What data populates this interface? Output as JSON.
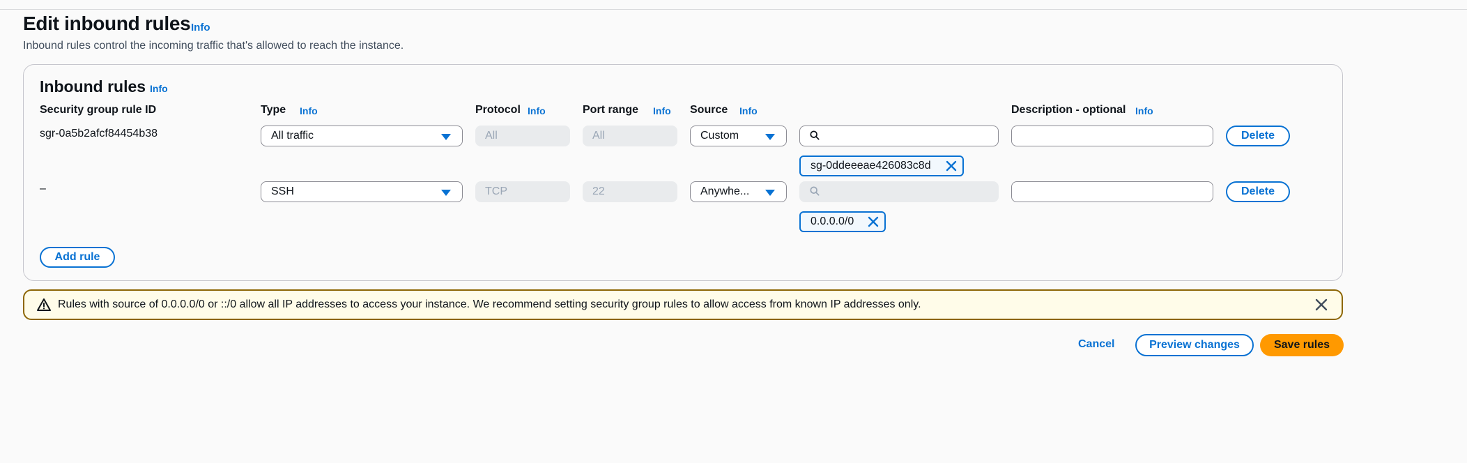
{
  "page": {
    "title": "Edit inbound rules",
    "info": "Info",
    "description": "Inbound rules control the incoming traffic that's allowed to reach the instance."
  },
  "panel": {
    "title": "Inbound rules",
    "info": "Info",
    "columns": {
      "rule_id": "Security group rule ID",
      "type": "Type",
      "protocol": "Protocol",
      "port_range": "Port range",
      "source": "Source",
      "description": "Description - optional",
      "info": "Info"
    },
    "rules": [
      {
        "id": "sgr-0a5b2afcf84454b38",
        "type": "All traffic",
        "protocol": "All",
        "port_range": "All",
        "source": "Custom",
        "search_placeholder": "",
        "token": "sg-0ddeeeae426083c8d",
        "description": "",
        "delete_label": "Delete"
      },
      {
        "id": "–",
        "type": "SSH",
        "protocol": "TCP",
        "port_range": "22",
        "source": "Anywhe...",
        "search_placeholder": "",
        "token": "0.0.0.0/0",
        "description": "",
        "delete_label": "Delete"
      }
    ],
    "add_rule_label": "Add rule"
  },
  "alert": {
    "text": "Rules with source of 0.0.0.0/0 or ::/0 allow all IP addresses to access your instance. We recommend setting security group rules to allow access from known IP addresses only."
  },
  "footer": {
    "cancel_label": "Cancel",
    "preview_label": "Preview changes",
    "save_label": "Save rules"
  },
  "colors": {
    "link": "#0972d3",
    "primary_button": "#ff9900",
    "warning_border": "#8d6605",
    "warning_background": "#fffce9"
  }
}
